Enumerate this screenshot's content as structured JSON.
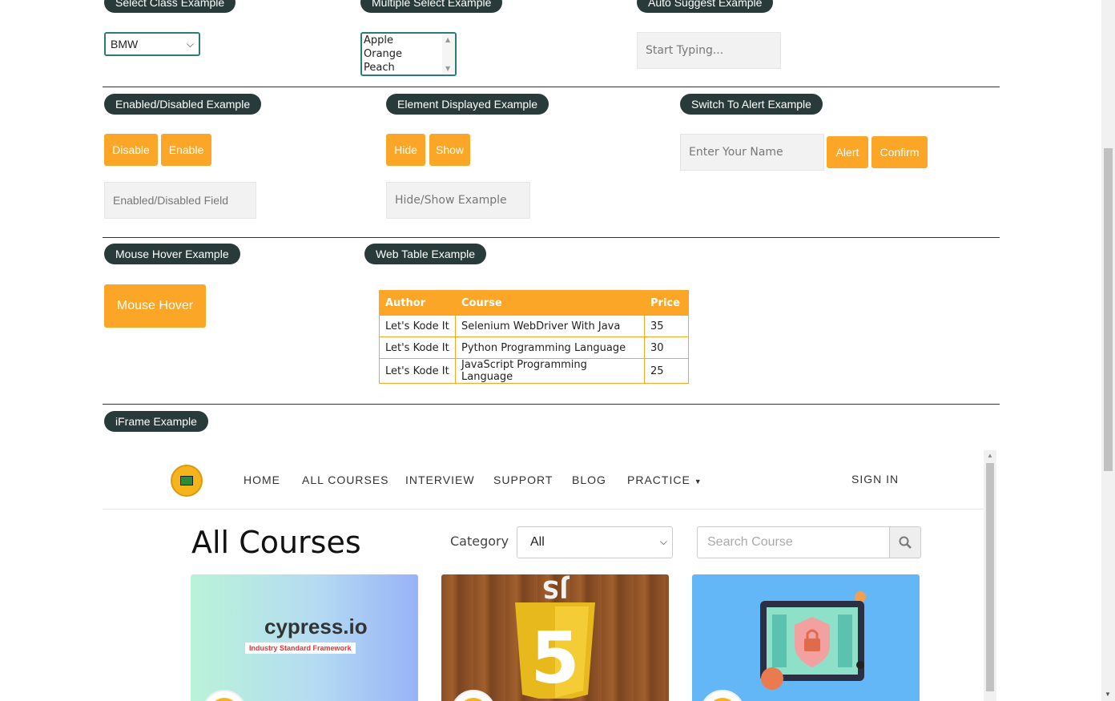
{
  "sections": {
    "select_class": "Select Class Example",
    "multiple_select": "Multiple Select Example",
    "auto_suggest": "Auto Suggest Example",
    "enabled_disabled": "Enabled/Disabled Example",
    "element_displayed": "Element Displayed Example",
    "switch_alert": "Switch To Alert Example",
    "mouse_hover": "Mouse Hover Example",
    "web_table": "Web Table Example",
    "iframe": "iFrame Example"
  },
  "select_class": {
    "value": "BMW"
  },
  "multiple_select": {
    "options": [
      "Apple",
      "Orange",
      "Peach"
    ]
  },
  "auto_suggest": {
    "placeholder": "Start Typing..."
  },
  "enabled_disabled": {
    "disable_label": "Disable",
    "enable_label": "Enable",
    "field_placeholder": "Enabled/Disabled Field"
  },
  "element_displayed": {
    "hide_label": "Hide",
    "show_label": "Show",
    "field_placeholder": "Hide/Show Example"
  },
  "switch_alert": {
    "name_placeholder": "Enter Your Name",
    "alert_label": "Alert",
    "confirm_label": "Confirm"
  },
  "mouse_hover": {
    "button_label": "Mouse Hover"
  },
  "web_table": {
    "headers": [
      "Author",
      "Course",
      "Price"
    ],
    "rows": [
      [
        "Let's Kode It",
        "Selenium WebDriver With Java",
        "35"
      ],
      [
        "Let's Kode It",
        "Python Programming Language",
        "30"
      ],
      [
        "Let's Kode It",
        "JavaScript Programming Language",
        "25"
      ]
    ]
  },
  "iframe_page": {
    "nav": [
      "HOME",
      "ALL COURSES",
      "INTERVIEW",
      "SUPPORT",
      "BLOG",
      "PRACTICE"
    ],
    "sign_in": "SIGN IN",
    "heading": "All Courses",
    "category_label": "Category",
    "category_value": "All",
    "search_placeholder": "Search Course",
    "card1_title": "cypress.io",
    "card1_tag": "Industry Standard Framework"
  },
  "colors": {
    "accent": "#fca627",
    "pill": "#283a3a",
    "select_border": "#2b7b7b"
  }
}
